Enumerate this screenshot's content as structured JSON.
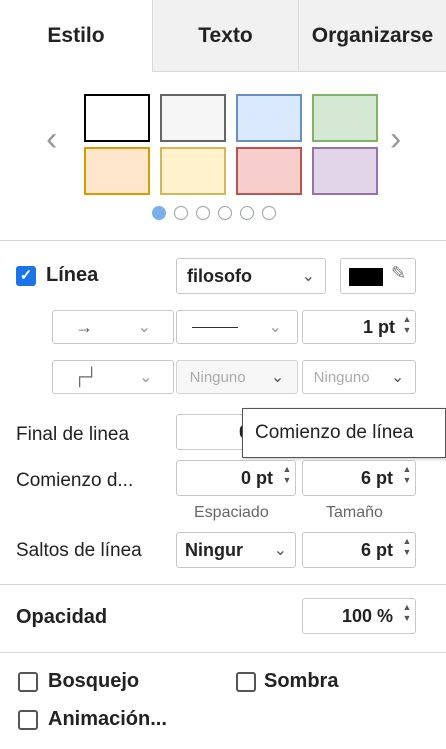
{
  "tabs": [
    {
      "label": "Estilo",
      "active": true
    },
    {
      "label": "Texto",
      "active": false
    },
    {
      "label": "Organizarse",
      "active": false
    }
  ],
  "swatches": [
    {
      "fill": "#ffffff",
      "stroke": "#000000"
    },
    {
      "fill": "#f5f5f5",
      "stroke": "#666666"
    },
    {
      "fill": "#dae8fc",
      "stroke": "#6c8ebf"
    },
    {
      "fill": "#d5e8d4",
      "stroke": "#82b366"
    },
    {
      "fill": "#ffe6cc",
      "stroke": "#d79b00"
    },
    {
      "fill": "#fff2cc",
      "stroke": "#d6b656"
    },
    {
      "fill": "#f8cecc",
      "stroke": "#b85450"
    },
    {
      "fill": "#e1d5e7",
      "stroke": "#9673a6"
    }
  ],
  "pager": {
    "count": 6,
    "active_index": 0
  },
  "line": {
    "checkbox_checked": true,
    "label": "Línea",
    "style_select": "filosofo",
    "color": "#000000",
    "width_value": "1 pt"
  },
  "waypoints": {
    "start": "Ninguno",
    "end": "Ninguno"
  },
  "line_end": {
    "label": "Final de linea",
    "value_partial": "0"
  },
  "tooltip": "Comienzo de línea",
  "line_start": {
    "label": "Comienzo d...",
    "spacing": "0 pt",
    "size": "6 pt"
  },
  "sub_labels": {
    "spacing": "Espaciado",
    "size": "Tamaño"
  },
  "line_jumps": {
    "label": "Saltos de línea",
    "select": "Ningur",
    "size": "6 pt"
  },
  "opacity": {
    "label": "Opacidad",
    "value": "100 %"
  },
  "options": {
    "sketch": "Bosquejo",
    "shadow": "Sombra",
    "animation": "Animación..."
  }
}
